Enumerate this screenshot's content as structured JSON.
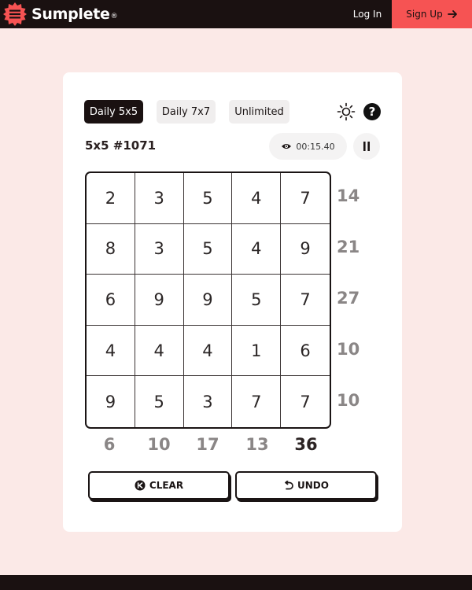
{
  "header": {
    "brand": "Sumplete",
    "brand_mark": "®",
    "login_label": "Log In",
    "signup_label": "Sign Up",
    "signup_color": "#f65353"
  },
  "tabs": [
    {
      "label": "Daily 5x5",
      "active": true
    },
    {
      "label": "Daily 7x7",
      "active": false
    },
    {
      "label": "Unlimited",
      "active": false
    }
  ],
  "icons": {
    "theme": "sun-icon",
    "help": "question-icon",
    "timer": "eye-icon",
    "pause": "pause-icon",
    "clear": "clear-icon",
    "undo": "undo-icon"
  },
  "help_label": "?",
  "puzzle_id": "5x5 #1071",
  "timer": "00:15.40",
  "grid": [
    [
      "2",
      "3",
      "5",
      "4",
      "7"
    ],
    [
      "8",
      "3",
      "5",
      "4",
      "9"
    ],
    [
      "6",
      "9",
      "9",
      "5",
      "7"
    ],
    [
      "4",
      "4",
      "4",
      "1",
      "6"
    ],
    [
      "9",
      "5",
      "3",
      "7",
      "7"
    ]
  ],
  "row_targets": [
    "14",
    "21",
    "27",
    "10",
    "10"
  ],
  "col_targets": [
    "6",
    "10",
    "17",
    "13",
    "36"
  ],
  "col_completed": [
    false,
    false,
    false,
    false,
    true
  ],
  "buttons": {
    "clear": "CLEAR",
    "undo": "UNDO"
  }
}
